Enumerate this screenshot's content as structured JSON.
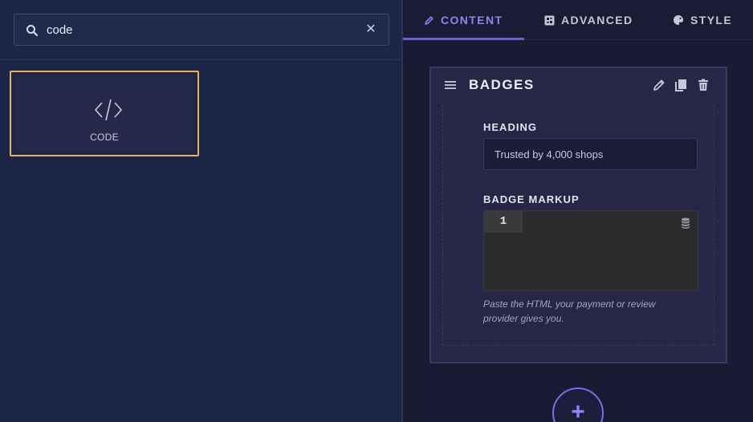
{
  "search": {
    "value": "code",
    "placeholder": ""
  },
  "widgets": [
    {
      "label": "CODE",
      "icon": "code-icon"
    }
  ],
  "tabs": [
    {
      "label": "CONTENT",
      "icon": "pencil-icon",
      "active": true
    },
    {
      "label": "ADVANCED",
      "icon": "advanced-icon",
      "active": false
    },
    {
      "label": "STYLE",
      "icon": "palette-icon",
      "active": false
    }
  ],
  "section": {
    "title": "BADGES",
    "fields": {
      "heading": {
        "label": "HEADING",
        "value": "Trusted by 4,000 shops"
      },
      "markup": {
        "label": "BADGE MARKUP",
        "line_number": "1",
        "help": "Paste the HTML your payment or review provider gives you."
      }
    }
  },
  "add_button": {
    "label": "+"
  },
  "colors": {
    "accent": "#7b6fe6",
    "highlight": "#e5b45e",
    "left_bg": "#1a2444",
    "right_bg": "#1b1a33"
  }
}
